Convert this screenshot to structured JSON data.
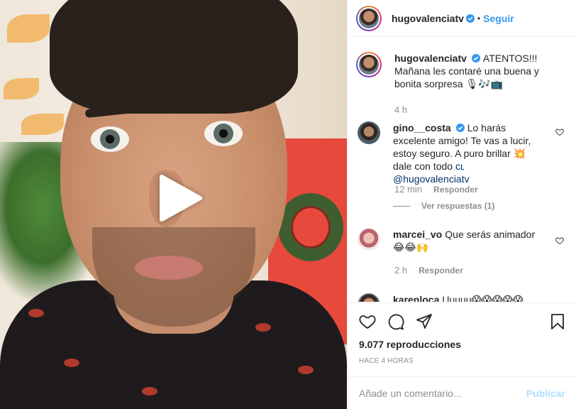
{
  "post": {
    "author": "hugovalenciatv",
    "follow_label": "Seguir",
    "separator": "•"
  },
  "caption": {
    "username": "hugovalenciatv",
    "text": "ATENTOS!!! Mañana les contaré una buena y bonita sorpresa 🎙🎶📺",
    "time": "4 h"
  },
  "comments": [
    {
      "username": "gino__costa",
      "text_before": "Lo harás excelente amigo! Te vas a lucir, estoy seguro. A puro brillar 💥 dale con todo ",
      "mention": "ᴄʟ @hugovalenciatv",
      "time": "12 min",
      "reply_label": "Responder",
      "view_replies": "Ver respuestas (1)"
    },
    {
      "username": "marcei_vo",
      "text": "Que serás animador 😂😂🙌",
      "time": "2 h",
      "reply_label": "Responder"
    },
    {
      "username": "karenloca",
      "text": "Uuuuu😱😱😱😱😱"
    }
  ],
  "stats": {
    "views": "9.077 reproducciones",
    "time_ago": "HACE 4 HORAS"
  },
  "add_comment": {
    "placeholder": "Añade un comentario...",
    "publish_label": "Publicar"
  },
  "colors": {
    "link_blue": "#3897f0",
    "publish_disabled": "#b2dffc",
    "muted": "#8e8e8e"
  }
}
